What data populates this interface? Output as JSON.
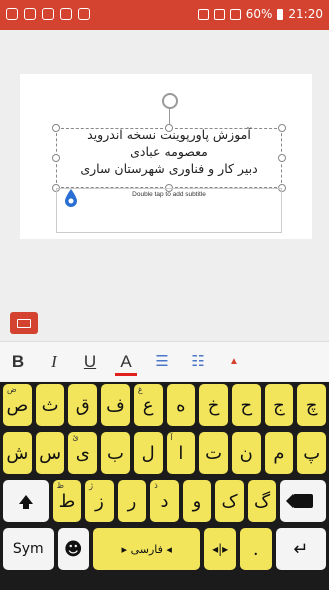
{
  "status": {
    "battery": "60%",
    "time": "21:20"
  },
  "slide": {
    "title_lines": [
      "آموزش پاورپوینت نسخه اندروید",
      "معصومه عبادی",
      "دبیر کار و فناوری شهرستان ساری"
    ],
    "subtitle_placeholder": "Double tap to add subtitle"
  },
  "format_bar": {
    "bold": "B",
    "italic": "I",
    "underline": "U",
    "font_color": "A",
    "font_color_hex": "#e0201c"
  },
  "keyboard": {
    "row1": [
      {
        "k": "ص",
        "h": "ض"
      },
      {
        "k": "ث",
        "h": ""
      },
      {
        "k": "ق",
        "h": ""
      },
      {
        "k": "ف",
        "h": ""
      },
      {
        "k": "ع",
        "h": "غ"
      },
      {
        "k": "ه",
        "h": ""
      },
      {
        "k": "خ",
        "h": ""
      },
      {
        "k": "ح",
        "h": ""
      },
      {
        "k": "ج",
        "h": ""
      },
      {
        "k": "چ",
        "h": ""
      }
    ],
    "row2": [
      {
        "k": "ش",
        "h": ""
      },
      {
        "k": "س",
        "h": ""
      },
      {
        "k": "ی",
        "h": "ئ"
      },
      {
        "k": "ب",
        "h": ""
      },
      {
        "k": "ل",
        "h": ""
      },
      {
        "k": "ا",
        "h": "آ"
      },
      {
        "k": "ت",
        "h": ""
      },
      {
        "k": "ن",
        "h": ""
      },
      {
        "k": "م",
        "h": ""
      },
      {
        "k": "پ",
        "h": ""
      }
    ],
    "row3": [
      {
        "k": "ط",
        "h": "ظ"
      },
      {
        "k": "ز",
        "h": "ژ"
      },
      {
        "k": "ر",
        "h": ""
      },
      {
        "k": "د",
        "h": "ذ"
      },
      {
        "k": "و",
        "h": ""
      },
      {
        "k": "ک",
        "h": ""
      },
      {
        "k": "گ",
        "h": ""
      }
    ],
    "sym": "Sym",
    "space_label": "◂ فارسی ▸",
    "period": "."
  }
}
